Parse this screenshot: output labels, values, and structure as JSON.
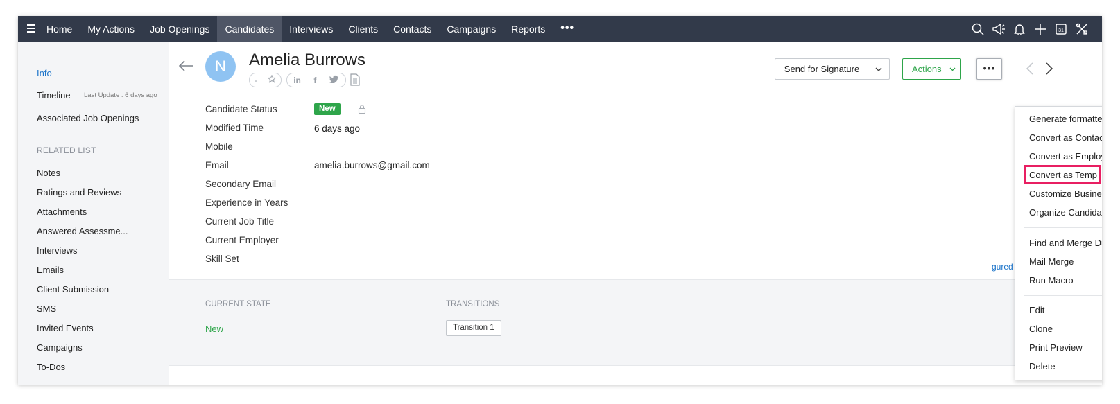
{
  "topnav": {
    "items": [
      "Home",
      "My Actions",
      "Job Openings",
      "Candidates",
      "Interviews",
      "Clients",
      "Contacts",
      "Campaigns",
      "Reports"
    ],
    "active": "Candidates",
    "more_label": "•••",
    "icons": [
      "search-icon",
      "megaphone-icon",
      "bell-icon",
      "plus-icon",
      "calendar-icon",
      "tools-icon"
    ],
    "calendar_day": "31"
  },
  "sidebar": {
    "info": "Info",
    "timeline": "Timeline",
    "timeline_meta": "Last Update : 6 days ago",
    "associated": "Associated Job Openings",
    "related_heading": "RELATED LIST",
    "related_items": [
      "Notes",
      "Ratings and Reviews",
      "Attachments",
      "Answered Assessme...",
      "Interviews",
      "Emails",
      "Client Submission",
      "SMS",
      "Invited Events",
      "Campaigns",
      "To-Dos"
    ]
  },
  "candidate": {
    "initial": "N",
    "name": "Amelia Burrows",
    "rating_dash": "-",
    "social": [
      "in",
      "f",
      "t"
    ]
  },
  "fields": [
    {
      "label": "Candidate Status",
      "value": ""
    },
    {
      "label": "Modified Time",
      "value": "6 days ago"
    },
    {
      "label": "Mobile",
      "value": ""
    },
    {
      "label": "Email",
      "value": "amelia.burrows@gmail.com"
    },
    {
      "label": "Secondary Email",
      "value": ""
    },
    {
      "label": "Experience in Years",
      "value": ""
    },
    {
      "label": "Current Job Title",
      "value": ""
    },
    {
      "label": "Current Employer",
      "value": ""
    },
    {
      "label": "Skill Set",
      "value": ""
    }
  ],
  "status_badge": "New",
  "process": {
    "current_state_label": "CURRENT STATE",
    "current_state": "New",
    "transitions_label": "TRANSITIONS",
    "transition_button": "Transition 1",
    "link": "gured Process"
  },
  "header_buttons": {
    "send_signature": "Send for Signature",
    "actions": "Actions",
    "more": "•••"
  },
  "dropdown": {
    "group1": [
      "Generate formatted resume",
      "Convert as Contact",
      "Convert as Employee",
      "Convert as Temp",
      "Customize Business Card",
      "Organize Candidate Details"
    ],
    "group2": [
      "Find and Merge Duplicates",
      "Mail Merge",
      "Run Macro"
    ],
    "group3": [
      "Edit",
      "Clone",
      "Print Preview",
      "Delete"
    ],
    "highlighted": "Convert as Temp"
  },
  "colors": {
    "nav_bg": "#323a4a",
    "accent_green": "#2ea54a",
    "link_blue": "#1a73c9",
    "highlight": "#e81f62"
  }
}
